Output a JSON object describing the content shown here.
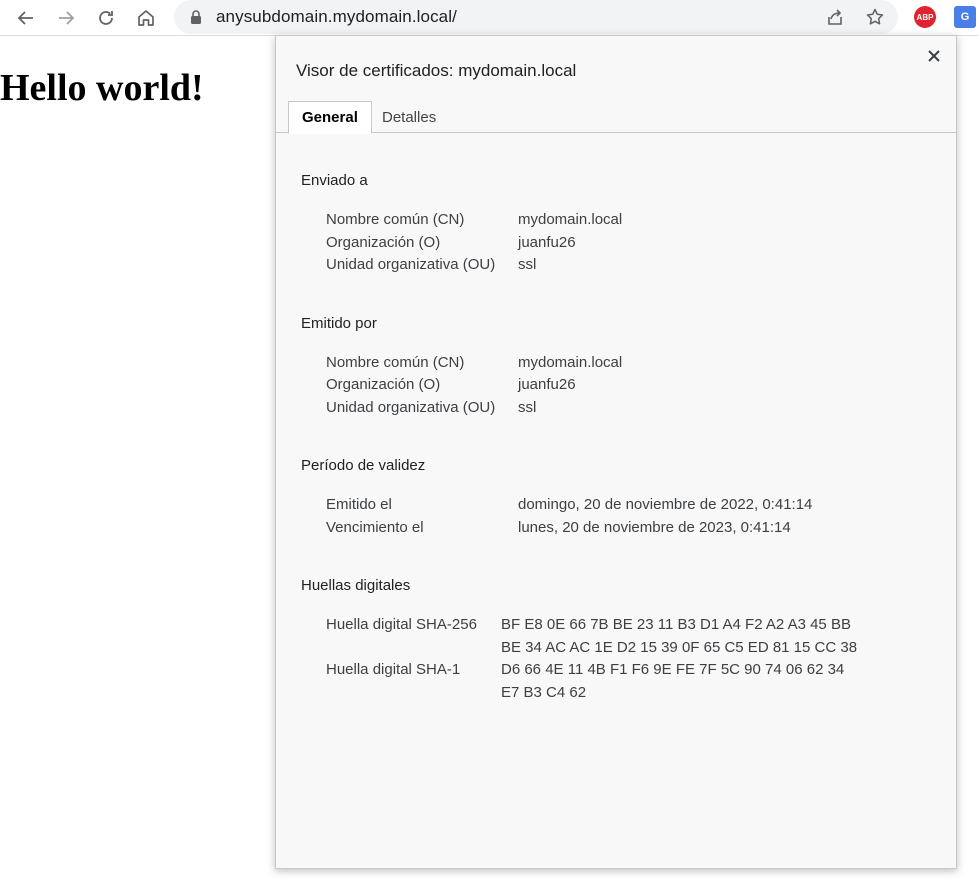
{
  "browser": {
    "url": "anysubdomain.mydomain.local/",
    "abp_label": "ABP",
    "translate_label": "G"
  },
  "page": {
    "heading": "Hello world!"
  },
  "dialog": {
    "title": "Visor de certificados: mydomain.local",
    "close_symbol": "×",
    "tabs": [
      {
        "label": "General",
        "active": true
      },
      {
        "label": "Detalles",
        "active": false
      }
    ],
    "issued_to": {
      "title": "Enviado a",
      "rows": [
        {
          "label": "Nombre común (CN)",
          "value": "mydomain.local"
        },
        {
          "label": "Organización (O)",
          "value": "juanfu26"
        },
        {
          "label": "Unidad organizativa (OU)",
          "value": "ssl"
        }
      ]
    },
    "issued_by": {
      "title": "Emitido por",
      "rows": [
        {
          "label": "Nombre común (CN)",
          "value": "mydomain.local"
        },
        {
          "label": "Organización (O)",
          "value": "juanfu26"
        },
        {
          "label": "Unidad organizativa (OU)",
          "value": "ssl"
        }
      ]
    },
    "validity": {
      "title": "Período de validez",
      "rows": [
        {
          "label": "Emitido el",
          "value": "domingo, 20 de noviembre de 2022, 0:41:14"
        },
        {
          "label": "Vencimiento el",
          "value": "lunes, 20 de noviembre de 2023, 0:41:14"
        }
      ]
    },
    "fingerprints": {
      "title": "Huellas digitales",
      "rows": [
        {
          "label": "Huella digital SHA-256",
          "line1": "BF E8 0E 66 7B BE 23 11 B3 D1 A4 F2 A2 A3 45 BB",
          "line2": "BE 34 AC AC 1E D2 15 39 0F 65 C5 ED 81 15 CC 38"
        },
        {
          "label": "Huella digital SHA-1",
          "line1": "D6 66 4E 11 4B F1 F6 9E FE 7F 5C 90 74 06 62 34",
          "line2": "E7 B3 C4 62"
        }
      ]
    }
  }
}
